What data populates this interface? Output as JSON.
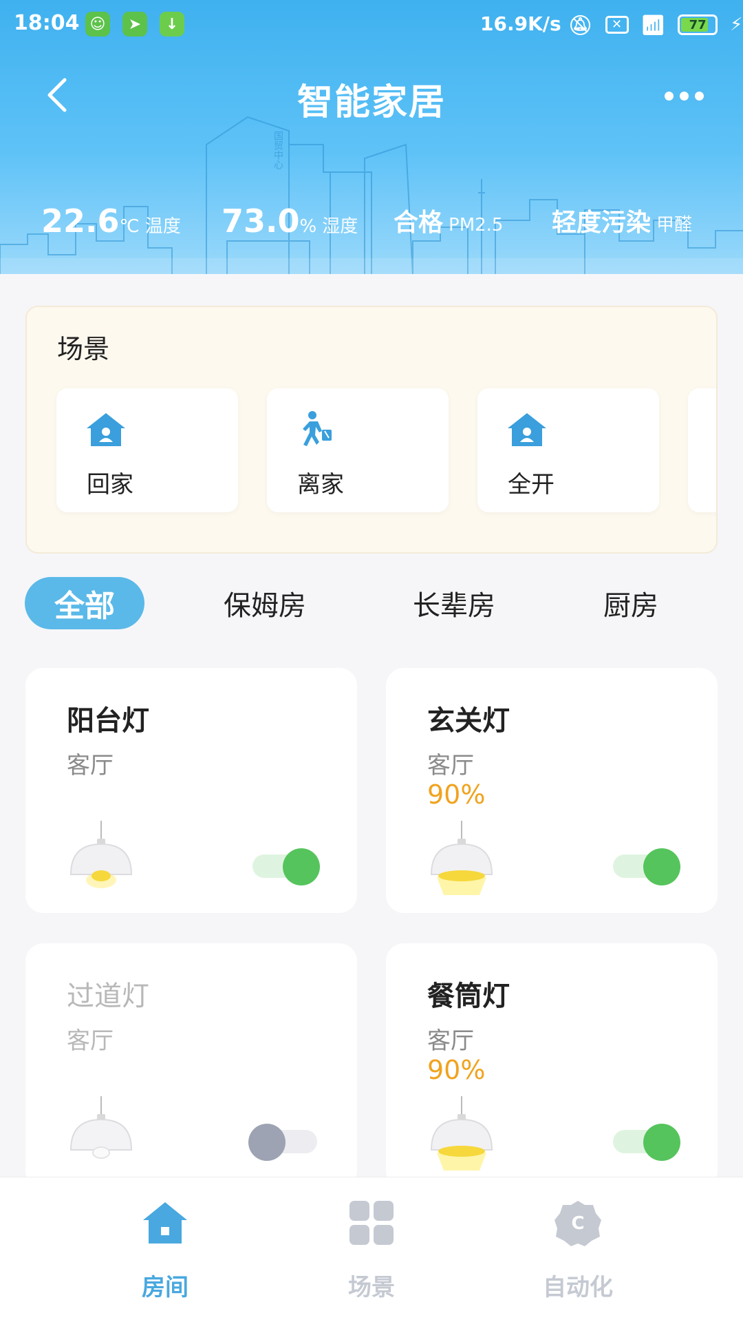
{
  "status_bar": {
    "time": "18:04",
    "net_speed": "16.9K/s",
    "battery": "77"
  },
  "header": {
    "title": "智能家居",
    "temperature": {
      "value": "22.6",
      "unit": "℃",
      "label": "温度"
    },
    "humidity": {
      "value": "73.0",
      "unit": "%",
      "label": "湿度"
    },
    "pm25": {
      "value": "合格",
      "label": "PM2.5"
    },
    "formaldehyde": {
      "value": "轻度污染",
      "label": "甲醛"
    },
    "building_sign": "国贸中心"
  },
  "scenes": {
    "title": "场景",
    "items": [
      {
        "label": "回家",
        "icon": "home-user-icon"
      },
      {
        "label": "离家",
        "icon": "walking-person-icon"
      },
      {
        "label": "全开",
        "icon": "home-user-icon"
      }
    ]
  },
  "room_tabs": [
    "全部",
    "保姆房",
    "长辈房",
    "厨房"
  ],
  "devices": [
    {
      "name": "阳台灯",
      "room": "客厅",
      "level": "",
      "on": true,
      "bright": false
    },
    {
      "name": "玄关灯",
      "room": "客厅",
      "level": "90%",
      "on": true,
      "bright": true
    },
    {
      "name": "过道灯",
      "room": "客厅",
      "level": "",
      "on": false,
      "bright": false
    },
    {
      "name": "餐筒灯",
      "room": "客厅",
      "level": "90%",
      "on": true,
      "bright": true
    }
  ],
  "bottom_nav": [
    {
      "label": "房间",
      "icon": "house-icon",
      "active": true
    },
    {
      "label": "场景",
      "icon": "grid-icon",
      "active": false
    },
    {
      "label": "自动化",
      "icon": "gear-icon",
      "active": false
    }
  ],
  "colors": {
    "accent": "#49a8df",
    "tab_active": "#5ab9e8",
    "level_text": "#f0a31e",
    "toggle_on": "#56c45c",
    "toggle_off": "#9da3b2"
  }
}
